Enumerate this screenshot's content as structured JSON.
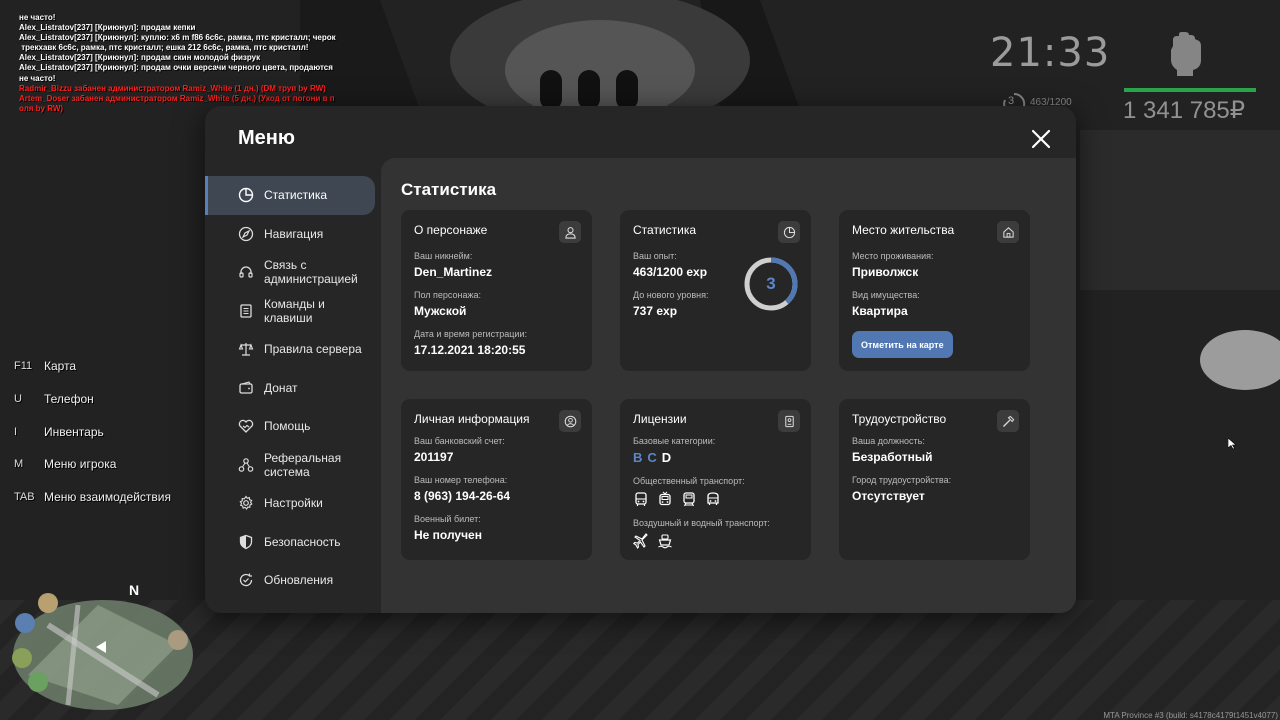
{
  "chat": [
    {
      "text": "не часто!",
      "color": "white"
    },
    {
      "text": "Alex_Listratov[237] [Криюнул]: продам кепки",
      "color": "white"
    },
    {
      "text": "Alex_Listratov[237] [Криюнул]: куплю: х6 m f86 6с6с, рамка, птс кристалл; черок",
      "color": "white"
    },
    {
      "text": " трекхавк 6с6с, рамка, птс кристалл; ешка 212 6с6с, рамка, птс кристалл!",
      "color": "white"
    },
    {
      "text": "Alex_Listratov[237] [Криюнул]: продам скин молодой физрук",
      "color": "white"
    },
    {
      "text": "Alex_Listratov[237] [Криюнул]: продам очки версачи черного цвета, продаются",
      "color": "white"
    },
    {
      "text": "не часто!",
      "color": "white"
    },
    {
      "text": "Radmir_Bizzu забанен администратором Ramiz_White (1 дн.) (DM труп by RW)",
      "color": "red"
    },
    {
      "text": "Artem_Doser забанен администратором Ramiz_White (5 дн.) (Уход от погони в п",
      "color": "red"
    },
    {
      "text": "оля by RW)",
      "color": "red"
    }
  ],
  "hud": {
    "clock": "21:33",
    "level": "3",
    "exp": "463/1200",
    "money": "1 341 785₽"
  },
  "hotkeys": [
    {
      "key": "F11",
      "label": "Карта"
    },
    {
      "key": "U",
      "label": "Телефон"
    },
    {
      "key": "I",
      "label": "Инвентарь"
    },
    {
      "key": "M",
      "label": "Меню игрока"
    },
    {
      "key": "TAB",
      "label": "Меню взаимодействия"
    }
  ],
  "minimap": {
    "north": "N"
  },
  "build_info": "MTA Province #3 (build: s4178c4179t1451v4077)",
  "menu": {
    "title": "Меню",
    "sidebar": [
      {
        "label": "Статистика",
        "icon": "pie-chart-icon",
        "active": true
      },
      {
        "label": "Навигация",
        "icon": "compass-icon"
      },
      {
        "label": "Связь с\nадминистрацией",
        "icon": "headset-icon"
      },
      {
        "label": "Команды и\nклавиши",
        "icon": "document-icon"
      },
      {
        "label": "Правила сервера",
        "icon": "scales-icon"
      },
      {
        "label": "Донат",
        "icon": "wallet-icon"
      },
      {
        "label": "Помощь",
        "icon": "heart-handshake-icon"
      },
      {
        "label": "Реферальная\nсистема",
        "icon": "network-icon"
      },
      {
        "label": "Настройки",
        "icon": "gear-icon"
      },
      {
        "label": "Безопасность",
        "icon": "shield-icon"
      },
      {
        "label": "Обновления",
        "icon": "refresh-check-icon"
      }
    ],
    "content_title": "Статистика",
    "cards": {
      "character": {
        "title": "О персонаже",
        "nick_label": "Ваш никнейм:",
        "nick": "Den_Martinez",
        "gender_label": "Пол персонажа:",
        "gender": "Мужской",
        "reg_label": "Дата и время регистрации:",
        "reg": "17.12.2021 18:20:55"
      },
      "stats": {
        "title": "Статистика",
        "exp_label": "Ваш опыт:",
        "exp": "463/1200 exp",
        "next_label": "До нового уровня:",
        "next": "737 exp",
        "level": "3",
        "progress": 0.386
      },
      "residence": {
        "title": "Место жительства",
        "place_label": "Место проживания:",
        "place": "Приволжск",
        "prop_label": "Вид имущества:",
        "prop": "Квартира",
        "button": "Отметить на карте"
      },
      "personal": {
        "title": "Личная информация",
        "bank_label": "Ваш банковский счет:",
        "bank": "201197",
        "phone_label": "Ваш номер телефона:",
        "phone": "8 (963) 194-26-64",
        "military_label": "Военный билет:",
        "military": "Не получен"
      },
      "licenses": {
        "title": "Лицензии",
        "basic_label": "Базовые категории:",
        "cat_b": "B",
        "cat_c": "C",
        "cat_d": "D",
        "public_label": "Общественный транспорт:",
        "air_label": "Воздушный и водный транспорт:"
      },
      "employment": {
        "title": "Трудоустройство",
        "pos_label": "Ваша должность:",
        "pos": "Безработный",
        "city_label": "Город трудоустройства:",
        "city": "Отсутствует"
      }
    }
  },
  "colors": {
    "accent": "#5278b3",
    "active_bg": "#3f4753",
    "money_bar": "#2aa44a",
    "ban_text": "#ff1f1f"
  }
}
